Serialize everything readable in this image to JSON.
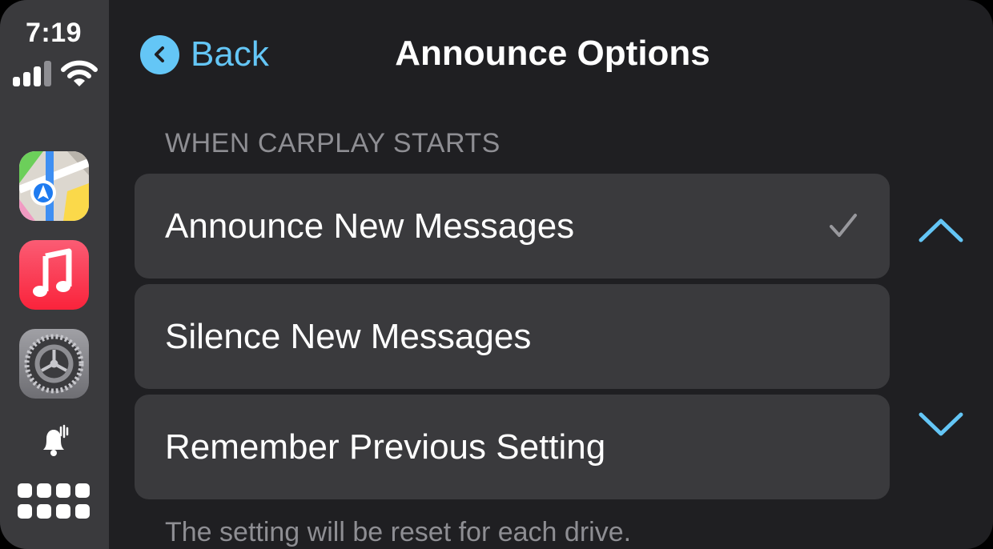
{
  "status_bar": {
    "time": "7:19",
    "signal_icon": "cellular-signal-icon",
    "wifi_icon": "wifi-icon"
  },
  "dock": {
    "apps": [
      {
        "name": "Maps",
        "icon": "maps-app-icon"
      },
      {
        "name": "Music",
        "icon": "music-app-icon"
      },
      {
        "name": "Settings",
        "icon": "settings-app-icon"
      }
    ],
    "announce_icon": "announce-notifications-icon",
    "home_icon": "app-grid-icon"
  },
  "header": {
    "back_label": "Back",
    "title": "Announce Options"
  },
  "section": {
    "header": "WHEN CARPLAY STARTS",
    "options": [
      {
        "label": "Announce New Messages",
        "selected": true
      },
      {
        "label": "Silence New Messages",
        "selected": false
      },
      {
        "label": "Remember Previous Setting",
        "selected": false
      }
    ],
    "footer": "The setting will be reset for each drive."
  },
  "colors": {
    "accent": "#64c6f6",
    "background": "#1f1f22",
    "row": "#3a3a3d",
    "secondary_text": "#8e8e93"
  }
}
